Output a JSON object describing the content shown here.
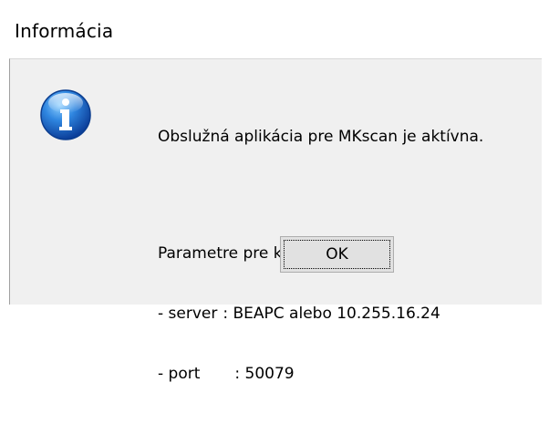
{
  "window": {
    "title": "Informácia"
  },
  "dialog": {
    "icon": "information-icon",
    "message": "Obslužná aplikácia pre MKscan je aktívna.",
    "params_heading": "Parametre pre komunikáciu:",
    "params": [
      {
        "label": "- server",
        "value": ": BEAPC alebo 10.255.16.24"
      },
      {
        "label": "- port",
        "value": ": 50079"
      }
    ],
    "ok_label": "OK"
  },
  "colors": {
    "client_background": "#f0f0f0",
    "button_background": "#e1e1e1",
    "icon_blue": "#1f6bcf"
  }
}
